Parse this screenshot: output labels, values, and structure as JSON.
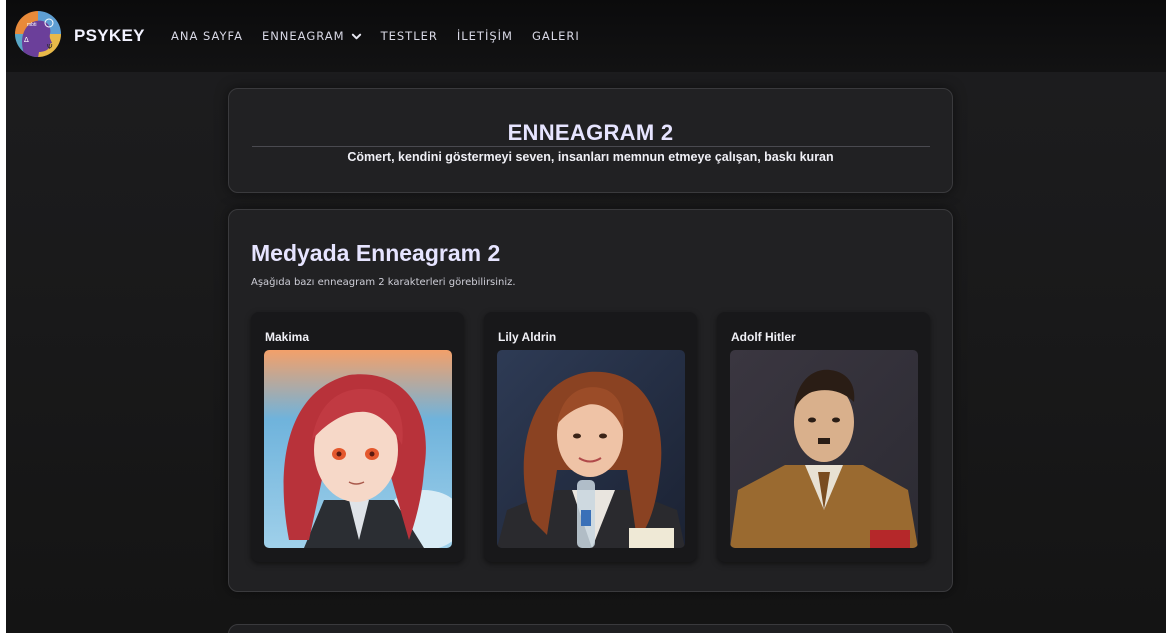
{
  "nav": {
    "brand": "PSYKEY",
    "links": [
      {
        "label": "ANA SAYFA"
      },
      {
        "label": "ENNEAGRAM",
        "dropdown": true
      },
      {
        "label": "TESTLER"
      },
      {
        "label": "İLETİŞİM"
      },
      {
        "label": "GALERI"
      }
    ]
  },
  "hero": {
    "title": "ENNEAGRAM 2",
    "subtitle": "Cömert, kendini göstermeyi seven, insanları memnun etmeye çalışan, baskı kuran"
  },
  "media": {
    "title": "Medyada Enneagram 2",
    "description": "Aşağıda bazı enneagram 2 karakterleri görebilirsiniz.",
    "characters": [
      {
        "name": "Makima"
      },
      {
        "name": "Lily Aldrin"
      },
      {
        "name": "Adolf Hitler"
      }
    ]
  }
}
